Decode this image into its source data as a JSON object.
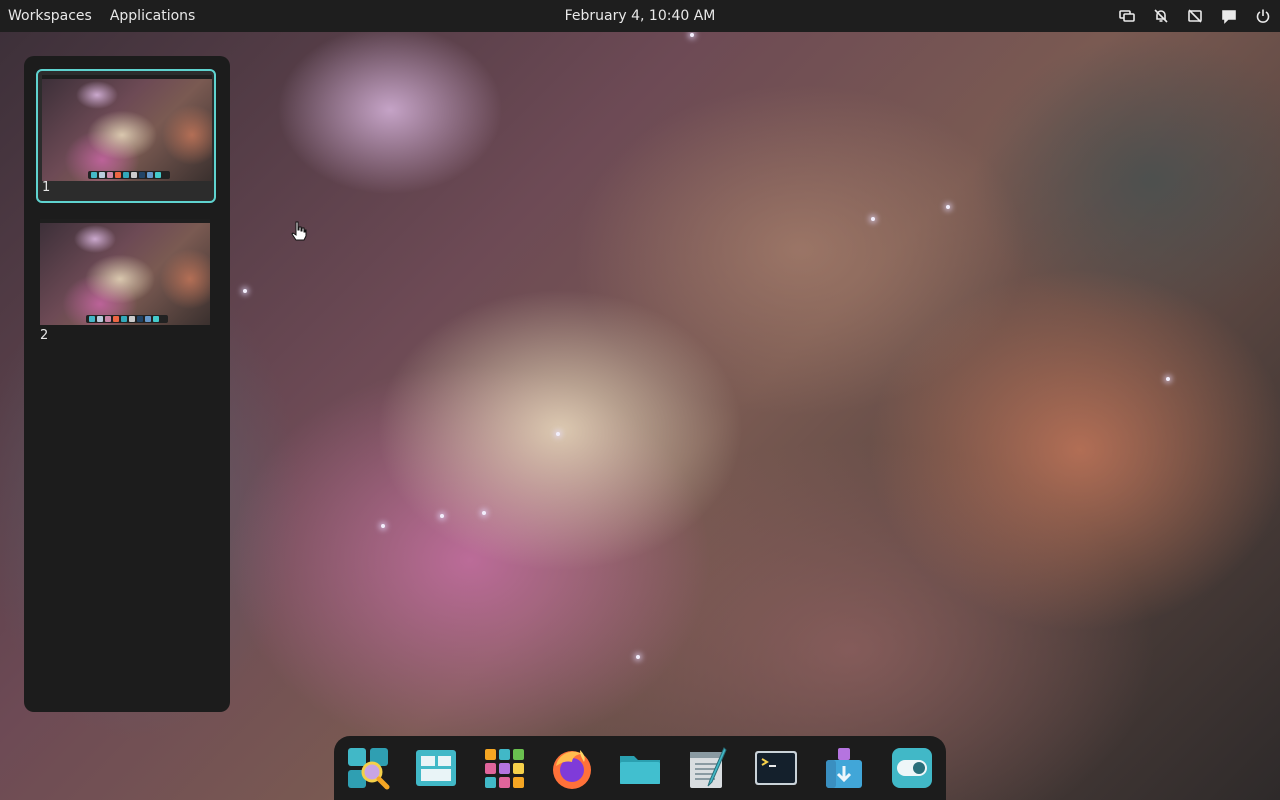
{
  "top_panel": {
    "workspaces_label": "Workspaces",
    "applications_label": "Applications",
    "clock": "February 4, 10:40 AM",
    "tray": [
      "display-icon",
      "notifications-muted-icon",
      "camera-off-icon",
      "chat-icon",
      "power-icon"
    ]
  },
  "workspaces": [
    {
      "number": "1",
      "active": true
    },
    {
      "number": "2",
      "active": false
    }
  ],
  "dock": {
    "apps": [
      "app-library-search-icon",
      "workspaces-icon",
      "app-grid-icon",
      "firefox-icon",
      "files-icon",
      "text-editor-icon",
      "terminal-icon",
      "store-icon",
      "settings-toggle-icon"
    ]
  },
  "colors": {
    "panel_bg": "#1e1e1e",
    "accent": "#5fd3cf",
    "sidebar_bg": "#1c1c1c"
  }
}
